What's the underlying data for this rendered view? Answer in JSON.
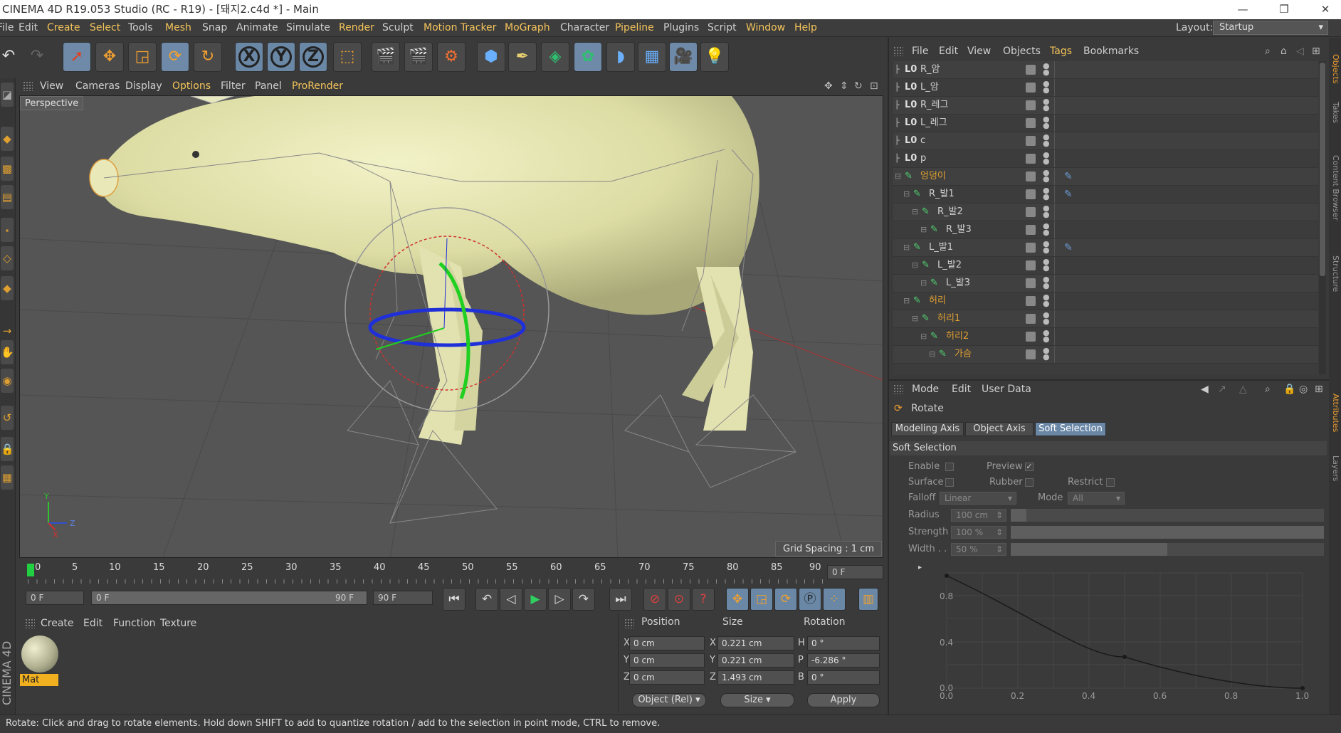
{
  "window": {
    "title": "CINEMA 4D R19.053 Studio (RC - R19) - [돼지2.c4d *] - Main"
  },
  "menu": [
    "File",
    "Edit",
    "Create",
    "Select",
    "Tools",
    "Mesh",
    "Snap",
    "Animate",
    "Simulate",
    "Render",
    "Sculpt",
    "Motion Tracker",
    "MoGraph",
    "Character",
    "Pipeline",
    "Plugins",
    "Script",
    "Window",
    "Help"
  ],
  "layout": {
    "label": "Layout:",
    "value": "Startup"
  },
  "viewport": {
    "menu": [
      "View",
      "Cameras",
      "Display",
      "Options",
      "Filter",
      "Panel",
      "ProRender"
    ],
    "label": "Perspective",
    "grid_spacing": "Grid Spacing : 1 cm"
  },
  "timeline": {
    "ticks": [
      "0",
      "5",
      "10",
      "15",
      "20",
      "25",
      "30",
      "35",
      "40",
      "45",
      "50",
      "55",
      "60",
      "65",
      "70",
      "75",
      "80",
      "85",
      "90"
    ],
    "current_frame": "0 F",
    "start": "0 F",
    "range_start": "0 F",
    "range_end": "90 F",
    "end": "90 F"
  },
  "material": {
    "menu": [
      "Create",
      "Edit",
      "Function",
      "Texture"
    ],
    "name": "Mat",
    "side_label": "CINEMA 4D"
  },
  "coords": {
    "headers": [
      "Position",
      "Size",
      "Rotation"
    ],
    "position": {
      "x": "0 cm",
      "y": "0 cm",
      "z": "0 cm"
    },
    "size": {
      "x": "0.221 cm",
      "y": "0.221 cm",
      "z": "1.493 cm"
    },
    "rotation": {
      "h": "0 °",
      "p": "-6.286 °",
      "b": "0 °"
    },
    "mode": "Object (Rel)",
    "size_mode": "Size",
    "apply": "Apply"
  },
  "objects": {
    "menu": [
      "File",
      "Edit",
      "View",
      "Objects",
      "Tags",
      "Bookmarks"
    ],
    "items": [
      {
        "name": "R_암",
        "depth": 0
      },
      {
        "name": "L_암",
        "depth": 0
      },
      {
        "name": "R_레그",
        "depth": 0
      },
      {
        "name": "L_레그",
        "depth": 0
      },
      {
        "name": "c",
        "depth": 0
      },
      {
        "name": "p",
        "depth": 0
      },
      {
        "name": "엉덩이",
        "depth": 0
      },
      {
        "name": "R_발1",
        "depth": 1
      },
      {
        "name": "R_발2",
        "depth": 2
      },
      {
        "name": "R_발3",
        "depth": 3
      },
      {
        "name": "L_발1",
        "depth": 1
      },
      {
        "name": "L_발2",
        "depth": 2
      },
      {
        "name": "L_발3",
        "depth": 3
      },
      {
        "name": "허리",
        "depth": 1
      },
      {
        "name": "허리1",
        "depth": 2
      },
      {
        "name": "허리2",
        "depth": 3
      },
      {
        "name": "가슴",
        "depth": 4
      }
    ]
  },
  "attributes": {
    "menu": [
      "Mode",
      "Edit",
      "User Data"
    ],
    "tool": "Rotate",
    "tabs": [
      "Modeling Axis",
      "Object Axis",
      "Soft Selection"
    ],
    "section": "Soft Selection",
    "enable": "Enable",
    "preview": "Preview",
    "surface": "Surface",
    "rubber": "Rubber",
    "restrict": "Restrict",
    "falloff_label": "Falloff",
    "falloff": "Linear",
    "mode_label": "Mode",
    "mode": "All",
    "radius_label": "Radius",
    "radius": "100 cm",
    "radius_level": 0.05,
    "strength_label": "Strength",
    "strength": "100 %",
    "strength_level": 1.0,
    "width_label": "Width . .",
    "width": "50 %",
    "width_level": 0.5,
    "curve_x": [
      "0.0",
      "0.2",
      "0.4",
      "0.6",
      "0.8",
      "1.0"
    ],
    "curve_y": [
      "0.8",
      "0.4",
      "0.0"
    ]
  },
  "side_tabs": [
    "Objects",
    "Takes",
    "Content Browser",
    "Structure"
  ],
  "side_tabs2": [
    "Attributes",
    "Layers"
  ],
  "status": "Rotate: Click and drag to rotate elements. Hold down SHIFT to add to quantize rotation / add to the selection in point mode, CTRL to remove."
}
